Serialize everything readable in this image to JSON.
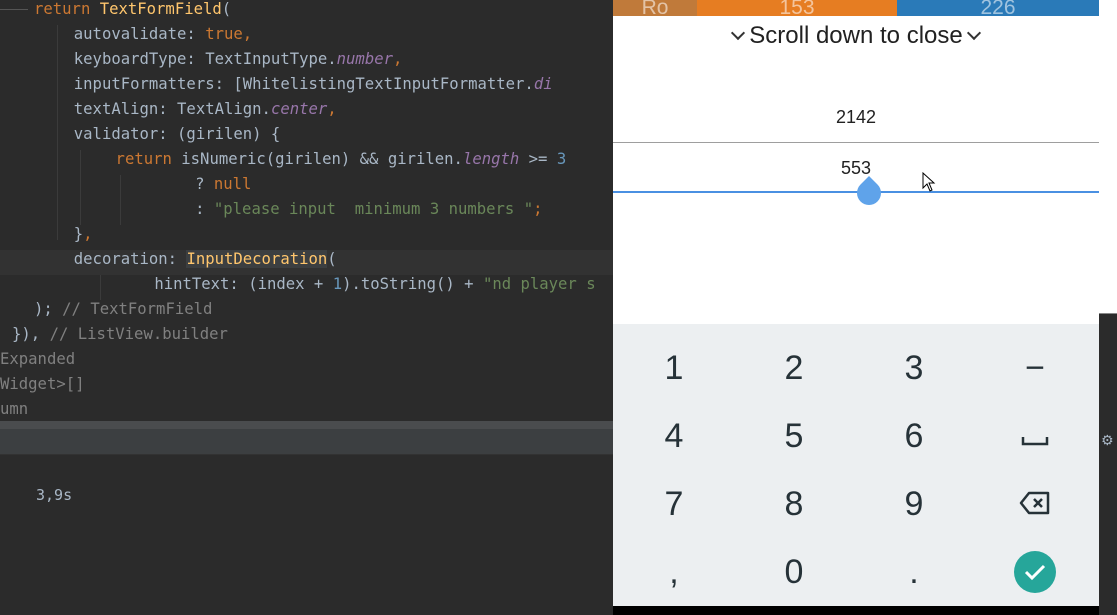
{
  "editor": {
    "lines": [
      [
        {
          "c": "kw",
          "t": "return "
        },
        {
          "c": "fn",
          "t": "TextFormField"
        },
        {
          "c": "",
          "t": "("
        }
      ],
      [
        {
          "c": "",
          "t": "  autovalidate: "
        },
        {
          "c": "kw",
          "t": "true"
        },
        {
          "c": "kw",
          "t": ","
        }
      ],
      [
        {
          "c": "",
          "t": "  keyboardType: TextInputType."
        },
        {
          "c": "prop",
          "t": "number"
        },
        {
          "c": "kw",
          "t": ","
        }
      ],
      [
        {
          "c": "",
          "t": "  inputFormatters: [WhitelistingTextInputFormatter."
        },
        {
          "c": "prop",
          "t": "di"
        }
      ],
      [
        {
          "c": "",
          "t": "  textAlign: TextAlign."
        },
        {
          "c": "prop",
          "t": "center"
        },
        {
          "c": "kw",
          "t": ","
        }
      ],
      [
        {
          "c": "",
          "t": "  validator: (girilen) {"
        }
      ],
      [
        {
          "c": "kw",
          "t": "    return "
        },
        {
          "c": "",
          "t": "isNumeric(girilen) && girilen."
        },
        {
          "c": "prop",
          "t": "length"
        },
        {
          "c": "",
          "t": " >= "
        },
        {
          "c": "num",
          "t": "3"
        }
      ],
      [
        {
          "c": "",
          "t": "        ? "
        },
        {
          "c": "kw",
          "t": "null"
        }
      ],
      [
        {
          "c": "",
          "t": "        : "
        },
        {
          "c": "str",
          "t": "\"please input  minimum 3 numbers \""
        },
        {
          "c": "kw",
          "t": ";"
        }
      ],
      [
        {
          "c": "",
          "t": "  }"
        },
        {
          "c": "kw",
          "t": ","
        }
      ],
      [
        {
          "c": "",
          "t": "  decoration: "
        },
        {
          "c": "hl",
          "t": "InputDecoration"
        },
        {
          "c": "",
          "t": "("
        }
      ],
      [
        {
          "c": "",
          "t": "      hintText: (index + "
        },
        {
          "c": "num",
          "t": "1"
        },
        {
          "c": "",
          "t": ").toString() + "
        },
        {
          "c": "str",
          "t": "\"nd player s"
        }
      ],
      [
        {
          "c": "",
          "t": "); "
        },
        {
          "c": "cmt",
          "t": "// TextFormField"
        }
      ],
      [
        {
          "c": "",
          "t": "}), "
        },
        {
          "c": "cmt",
          "t": "// ListView.builder"
        }
      ],
      [
        {
          "c": "cmt",
          "t": "Expanded"
        }
      ],
      [
        {
          "c": "cmt",
          "t": "Widget>[]"
        }
      ],
      [
        {
          "c": "cmt",
          "t": "umn"
        }
      ]
    ]
  },
  "run_panel": {
    "elapsed": "3,9s"
  },
  "phone": {
    "top_row": [
      {
        "label": "Ro",
        "color": "#c07a3a"
      },
      {
        "label": "153",
        "color": "#e67d22"
      },
      {
        "label": "226",
        "color": "#2a7ab8"
      }
    ],
    "sheet_title": "Scroll down to close",
    "field1_value": "2142",
    "field2_value": "553",
    "accent_color": "#4a90e2"
  },
  "keyboard": {
    "rows": [
      [
        "1",
        "2",
        "3",
        "−"
      ],
      [
        "4",
        "5",
        "6",
        "space-icon"
      ],
      [
        "7",
        "8",
        "9",
        "backspace-icon"
      ],
      [
        ",",
        "0",
        ".",
        "done-icon"
      ]
    ],
    "done_color": "#26a69a"
  }
}
